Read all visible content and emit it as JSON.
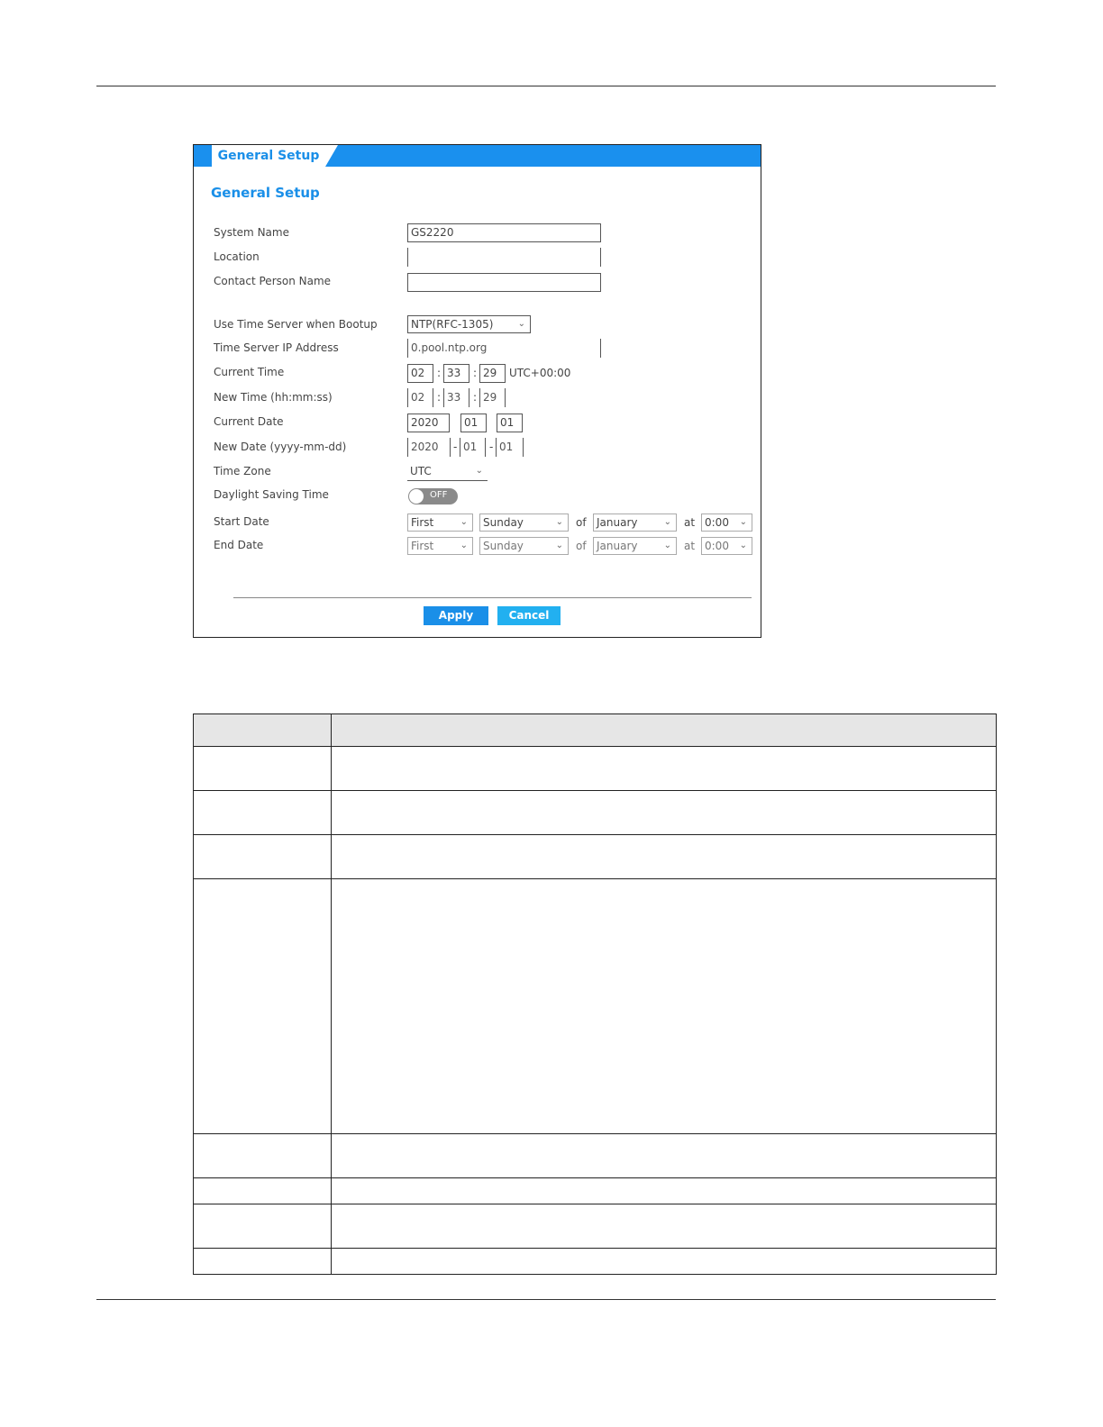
{
  "panel": {
    "tab_label": "General Setup",
    "section_title": "General Setup",
    "fields": {
      "system_name": {
        "label": "System Name",
        "value": "GS2220"
      },
      "location": {
        "label": "Location",
        "value": ""
      },
      "contact_person": {
        "label": "Contact Person Name",
        "value": ""
      },
      "time_server_boot": {
        "label": "Use Time Server when Bootup",
        "value": "NTP(RFC-1305)"
      },
      "time_server_ip": {
        "label": "Time Server IP Address",
        "value": "0.pool.ntp.org"
      },
      "current_time": {
        "label": "Current Time",
        "hh": "02",
        "mm": "33",
        "ss": "29",
        "suffix": "UTC+00:00"
      },
      "new_time": {
        "label": "New Time (hh:mm:ss)",
        "hh": "02",
        "mm": "33",
        "ss": "29"
      },
      "current_date": {
        "label": "Current Date",
        "yyyy": "2020",
        "mm": "01",
        "dd": "01"
      },
      "new_date": {
        "label": "New Date (yyyy-mm-dd)",
        "yyyy": "2020",
        "mm": "01",
        "dd": "01"
      },
      "time_zone": {
        "label": "Time Zone",
        "value": "UTC"
      },
      "dst": {
        "label": "Daylight Saving Time",
        "state": "OFF"
      },
      "start_date": {
        "label": "Start Date",
        "week": "First",
        "day": "Sunday",
        "of": "of",
        "month": "January",
        "at": "at",
        "time": "0:00"
      },
      "end_date": {
        "label": "End Date",
        "week": "First",
        "day": "Sunday",
        "of": "of",
        "month": "January",
        "at": "at",
        "time": "0:00"
      }
    },
    "separators": {
      "colon": ":",
      "dash": "-"
    },
    "buttons": {
      "apply": "Apply",
      "cancel": "Cancel"
    },
    "colors": {
      "accent": "#1a8fe8",
      "tab_bar": "#1a90ee",
      "cancel": "#22b0f0"
    }
  },
  "desc_table": {
    "rows": 9
  }
}
